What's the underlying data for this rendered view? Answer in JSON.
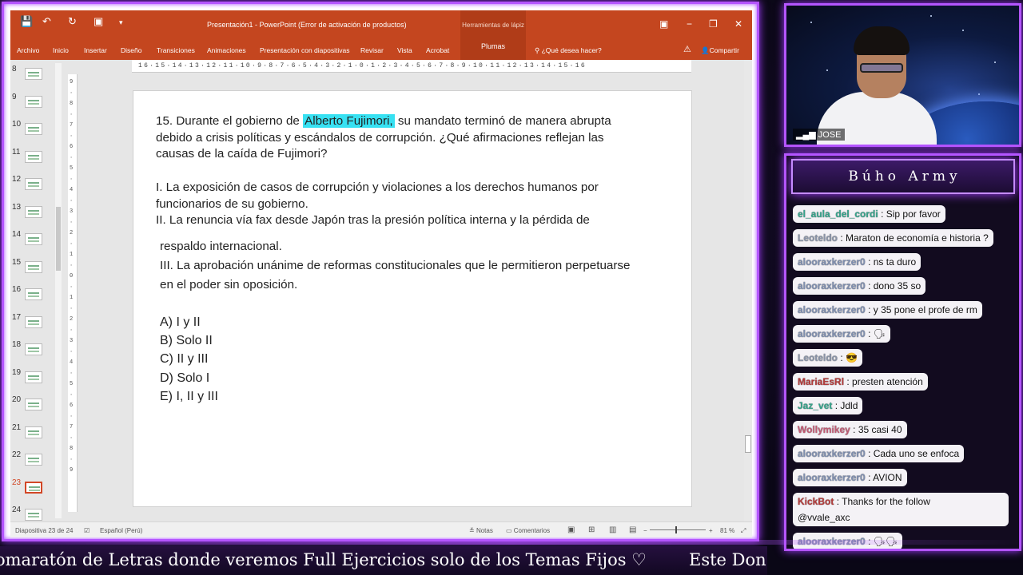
{
  "ppt": {
    "window_title": "Presentación1 - PowerPoint (Error de activación de productos)",
    "context_group": "Herramientas de lápiz",
    "context_tab": "Plumas",
    "tabs": [
      "Archivo",
      "Inicio",
      "Insertar",
      "Diseño",
      "Transiciones",
      "Animaciones",
      "Presentación con diapositivas",
      "Revisar",
      "Vista",
      "Acrobat"
    ],
    "tell_me": "¿Qué desea hacer?",
    "share": "Compartir",
    "ruler": "16·15·14·13·12·11·10·9·8·7·6·5·4·3·2·1·0·1·2·3·4·5·6·7·8·9·10·11·12·13·14·15·16",
    "vruler": "9·8·7·6·5·4·3·2·1·0·1·2·3·4·5·6·7·8·9",
    "thumbnails": [
      "8",
      "9",
      "10",
      "11",
      "12",
      "13",
      "14",
      "15",
      "16",
      "17",
      "18",
      "19",
      "20",
      "21",
      "22",
      "23",
      "24"
    ],
    "active_slide": "23",
    "status": {
      "slide_info": "Diapositiva 23 de 24",
      "language": "Español (Perú)",
      "notes": "Notas",
      "comments": "Comentarios",
      "zoom": "81 %"
    }
  },
  "slide": {
    "q_prefix": "15. Durante el gobierno de",
    "q_highlight": "Alberto Fujimori,",
    "q_rest": "su mandato terminó de manera abrupta debido a crisis políticas y escándalos de corrupción. ¿Qué afirmaciones reflejan las causas de la caída de Fujimori?",
    "stmt1": "I. La exposición de casos de corrupción y violaciones a los derechos humanos por funcionarios de su gobierno.",
    "stmt2": "II. La renuncia vía fax desde Japón tras la presión política interna y la pérdida de",
    "stmt2b": "respaldo internacional.",
    "stmt3": "III. La aprobación unánime de reformas constitucionales que le permitieron perpetuarse en el poder sin oposición.",
    "options": [
      "A) I y II",
      "B) Solo II",
      "C) II y III",
      "D) Solo I",
      "E) I, II y III"
    ]
  },
  "camera": {
    "label": "JOSE"
  },
  "chat": {
    "title": "Búho Army",
    "messages": [
      {
        "user": "el_aula_del_cordi",
        "text": ": Sip por favor",
        "cls": "u-green"
      },
      {
        "user": "Leoteldo",
        "text": ": Maraton de economía e historia ?",
        "cls": "u-gray"
      },
      {
        "user": "alooraxkerzer0",
        "text": ": ns ta duro",
        "cls": ""
      },
      {
        "user": "alooraxkerzer0",
        "text": ": dono 35 so",
        "cls": ""
      },
      {
        "user": "alooraxkerzer0",
        "text": ": y 35 pone el profe de rm",
        "cls": ""
      },
      {
        "user": "alooraxkerzer0",
        "text": ": 🗣",
        "cls": ""
      },
      {
        "user": "Leoteldo",
        "text": ": 😎",
        "cls": "u-gray"
      },
      {
        "user": "MariaEsRl",
        "text": ": presten atención",
        "cls": "u-red"
      },
      {
        "user": "Jaz_vet",
        "text": ": Jdld",
        "cls": "u-green"
      },
      {
        "user": "Wollymikey",
        "text": ": 35 casi 40",
        "cls": "u-pink"
      },
      {
        "user": "alooraxkerzer0",
        "text": ": Cada uno se enfoca",
        "cls": ""
      },
      {
        "user": "alooraxkerzer0",
        "text": ": AVION",
        "cls": ""
      },
      {
        "user": "KickBot",
        "text": ": Thanks for the follow",
        "cls": "u-red"
      },
      {
        "user": "",
        "text": "@vvale_axc",
        "cls": ""
      },
      {
        "user": "alooraxkerzer0",
        "text": ": 🗣🗣",
        "cls": ""
      }
    ]
  },
  "ticker": {
    "text": "omaratón de Letras donde veremos Full Ejercicios solo de los Temas Fijos ♡",
    "text2": "Este Don"
  },
  "colors": {
    "accent": "#b455ff",
    "office": "#c4461f",
    "highlight": "#37e1f2"
  }
}
